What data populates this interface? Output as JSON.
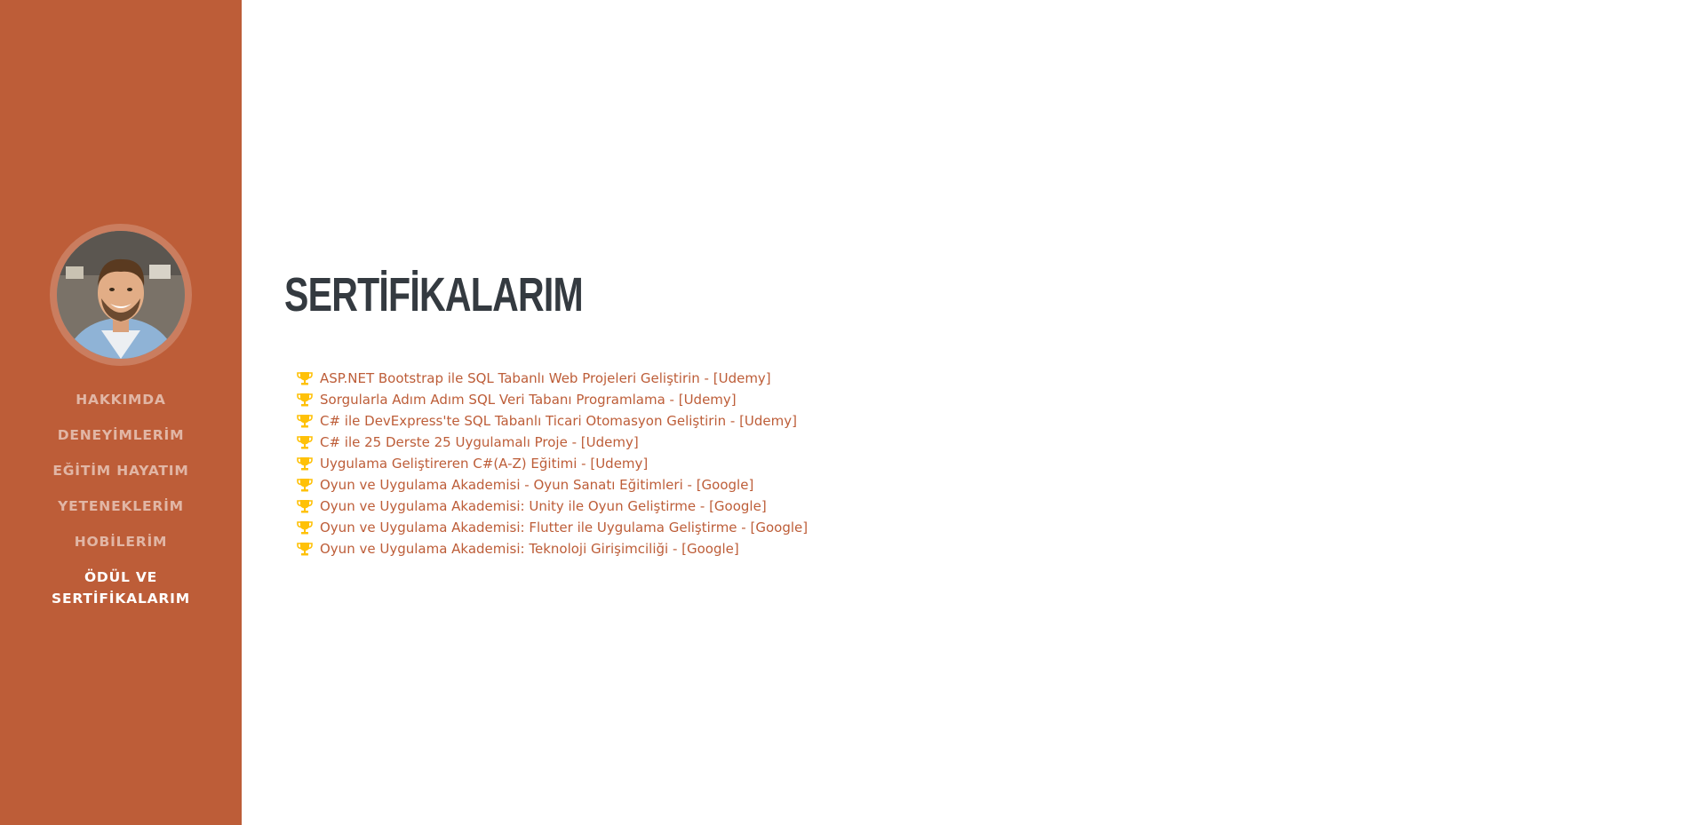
{
  "sidebar": {
    "avatar_alt": "profile photo",
    "nav": [
      {
        "label": "HAKKIMDA",
        "active": false
      },
      {
        "label": "DENEYİMLERİM",
        "active": false
      },
      {
        "label": "EĞİTİM HAYATIM",
        "active": false
      },
      {
        "label": "YETENEKLERİM",
        "active": false
      },
      {
        "label": "HOBİLERİM",
        "active": false
      },
      {
        "label": "ÖDÜL VE SERTİFİKALARIM",
        "active": true
      }
    ]
  },
  "main": {
    "title": "SERTİFİKALARIM",
    "certificates": [
      "ASP.NET Bootstrap ile SQL Tabanlı Web Projeleri Geliştirin - [Udemy]",
      "Sorgularla Adım Adım SQL Veri Tabanı Programlama - [Udemy]",
      "C# ile DevExpress'te SQL Tabanlı Ticari Otomasyon Geliştirin - [Udemy]",
      "C# ile 25 Derste 25 Uygulamalı Proje - [Udemy]",
      "Uygulama Geliştireren C#(A-Z) Eğitimi - [Udemy]",
      "Oyun ve Uygulama Akademisi - Oyun Sanatı Eğitimleri - [Google]",
      "Oyun ve Uygulama Akademisi: Unity ile Oyun Geliştirme - [Google]",
      "Oyun ve Uygulama Akademisi: Flutter ile Uygulama Geliştirme - [Google]",
      "Oyun ve Uygulama Akademisi: Teknoloji Girişimciliği - [Google]"
    ]
  },
  "colors": {
    "primary": "#bd5d38",
    "trophy": "#ffc107",
    "heading": "#343a40"
  },
  "icons": {
    "certificate_icon": "trophy-icon"
  }
}
